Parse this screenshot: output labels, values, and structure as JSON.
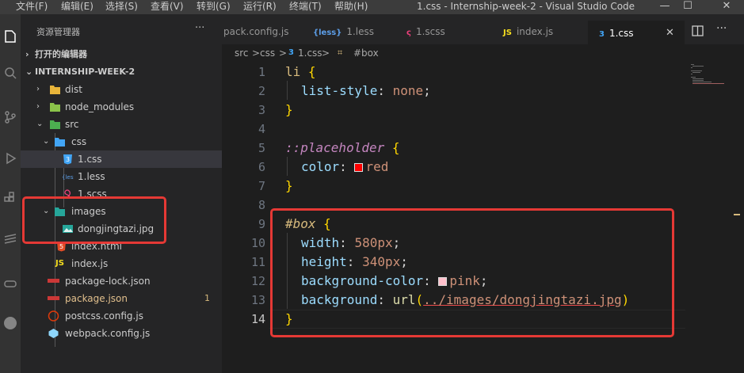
{
  "titlebar": {
    "menus": [
      "文件(F)",
      "编辑(E)",
      "选择(S)",
      "查看(V)",
      "转到(G)",
      "运行(R)",
      "终端(T)",
      "帮助(H)"
    ],
    "title": "1.css - Internship-week-2 - Visual Studio Code",
    "controls": [
      "—",
      "☐",
      "✕"
    ]
  },
  "sidebar": {
    "title": "资源管理器",
    "more": "···",
    "open_editors": "打开的编辑器",
    "workspace": "INTERNSHIP-WEEK-2",
    "tree": [
      {
        "label": "dist",
        "type": "folder",
        "expanded": false
      },
      {
        "label": "node_modules",
        "type": "folder",
        "expanded": false
      },
      {
        "label": "src",
        "type": "folder",
        "expanded": true
      },
      {
        "label": "css",
        "type": "folder",
        "expanded": true
      },
      {
        "label": "1.css",
        "type": "css"
      },
      {
        "label": "1.less",
        "type": "less"
      },
      {
        "label": "1.scss",
        "type": "scss"
      },
      {
        "label": "images",
        "type": "folder",
        "expanded": true
      },
      {
        "label": "dongjingtazi.jpg",
        "type": "image"
      },
      {
        "label": "index.html",
        "type": "html"
      },
      {
        "label": "index.js",
        "type": "js"
      },
      {
        "label": "package-lock.json",
        "type": "json"
      },
      {
        "label": "package.json",
        "type": "json",
        "badge": "1"
      },
      {
        "label": "postcss.config.js",
        "type": "config"
      },
      {
        "label": "webpack.config.js",
        "type": "webpack"
      }
    ]
  },
  "tabs": [
    {
      "label": "pack.config.js",
      "icon": ""
    },
    {
      "label": "1.less",
      "icon": "less"
    },
    {
      "label": "1.scss",
      "icon": "scss"
    },
    {
      "label": "index.js",
      "icon": "JS"
    },
    {
      "label": "1.css",
      "icon": "css",
      "active": true,
      "close": "✕"
    }
  ],
  "breadcrumb": [
    "src",
    ">",
    "css",
    ">",
    "1.css",
    ">",
    "#box"
  ],
  "editor": {
    "line_numbers": [
      "1",
      "2",
      "3",
      "4",
      "5",
      "6",
      "7",
      "8",
      "9",
      "10",
      "11",
      "12",
      "13",
      "14"
    ],
    "current_line": "14",
    "lines": {
      "l1_sel": "li",
      "l1_brace": " {",
      "l2_prop": "list-style",
      "l2_colon": ": ",
      "l2_val": "none",
      "l2_end": ";",
      "l3_brace": "}",
      "l5_sel": "::placeholder",
      "l5_brace": " {",
      "l6_prop": "color",
      "l6_colon": ": ",
      "l6_val": "red",
      "l7_brace": "}",
      "l9_sel": "#box",
      "l9_brace": " {",
      "l10_prop": "width",
      "l10_colon": ": ",
      "l10_val": "580px",
      "l10_end": ";",
      "l11_prop": "height",
      "l11_colon": ": ",
      "l11_val": "340px",
      "l11_end": ";",
      "l12_prop": "background-color",
      "l12_colon": ": ",
      "l12_val": "pink",
      "l12_end": ";",
      "l13_prop": "background",
      "l13_colon": ": ",
      "l13_fn": "url",
      "l13_open": "(",
      "l13_url": "../images/dongjingtazi.jpg",
      "l13_close": ")",
      "l14_brace": "}"
    },
    "swatches": {
      "red": "#ff0000",
      "pink": "#ffc0cb"
    }
  },
  "colors": {
    "highlight_box": "#e53935",
    "accent": "#007acc"
  }
}
